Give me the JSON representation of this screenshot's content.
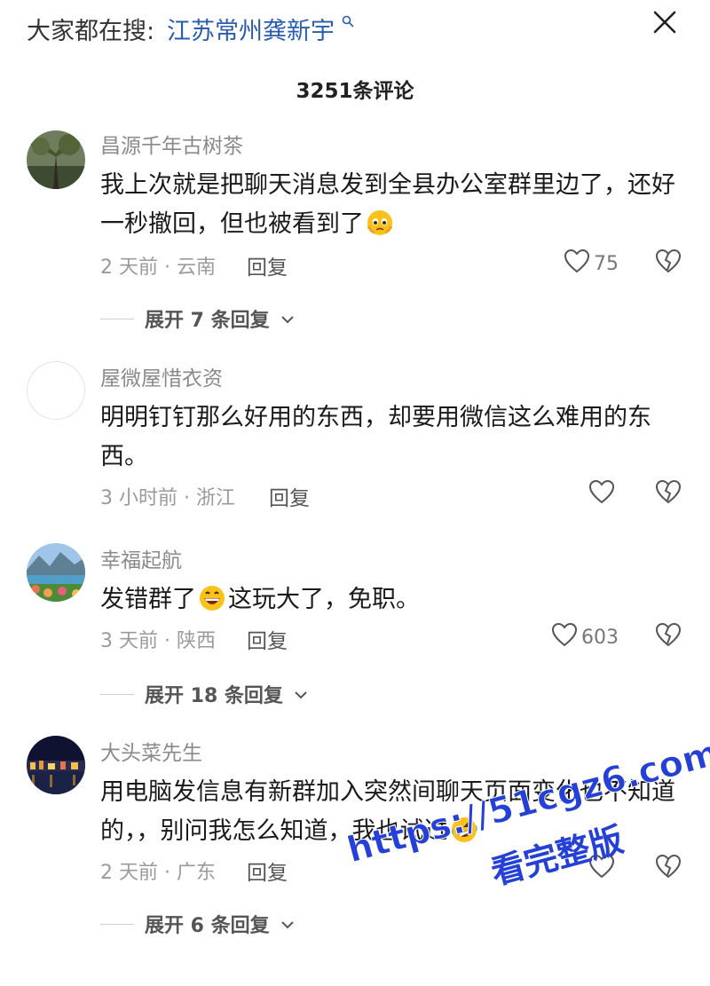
{
  "search_bar": {
    "prefix": "大家都在搜:",
    "query": "江苏常州龚新宇"
  },
  "comment_count": "3251条评论",
  "comments": [
    {
      "username": "昌源千年古树茶",
      "text_before": "我上次就是把聊天消息发到全县办公室群里边了，还好一秒撤回，但也被看到了",
      "text_after": "",
      "emoji": "pleading-face",
      "time_location": "2 天前 · 云南",
      "reply_label": "回复",
      "likes": "75",
      "expand_label": "展开 7 条回复"
    },
    {
      "username": "屋微屋惜衣资",
      "text_before": "明明钉钉那么好用的东西，却要用微信这么难用的东西。",
      "text_after": "",
      "time_location": "3 小时前 · 浙江",
      "reply_label": "回复",
      "likes": ""
    },
    {
      "username": "幸福起航",
      "text_before": "发错群了",
      "text_after": "这玩大了，免职。",
      "emoji": "grinning-face",
      "time_location": "3 天前 · 陕西",
      "reply_label": "回复",
      "likes": "603",
      "expand_label": "展开 18 条回复"
    },
    {
      "username": "大头菜先生",
      "text_before": "用电脑发信息有新群加入突然间聊天页面变化也不知道的，，别问我怎么知道，我也试过",
      "text_after": "",
      "emoji": "rolling-laughing-face",
      "time_location": "2 天前 · 广东",
      "reply_label": "回复",
      "likes": "",
      "expand_label": "展开 6 条回复"
    }
  ],
  "watermark": {
    "url": "https://51cgz6.com",
    "tagline": "看完整版"
  },
  "colors": {
    "link": "#2a5db0",
    "watermark": "#2540d6",
    "muted": "#9a9a9a"
  }
}
